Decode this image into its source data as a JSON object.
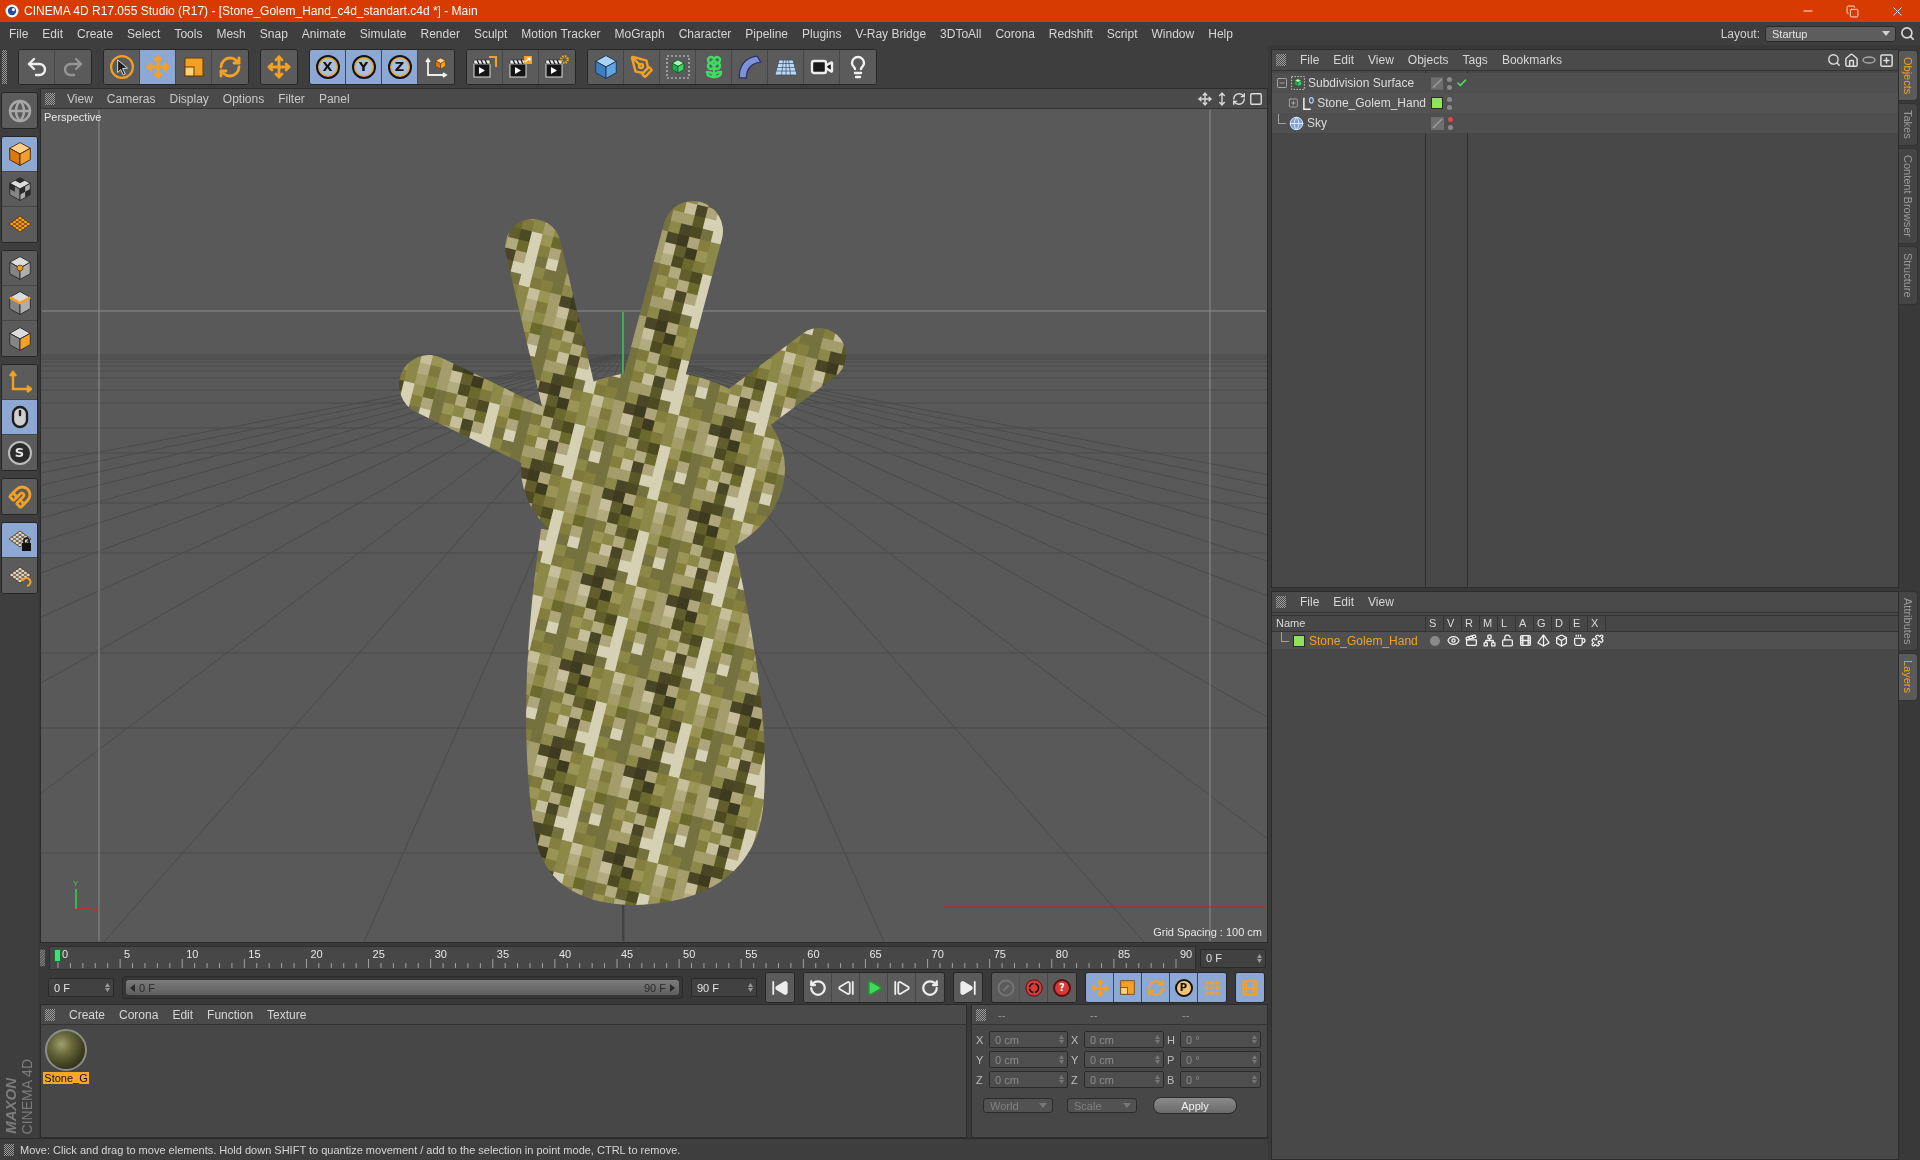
{
  "window": {
    "title": "CINEMA 4D R17.055 Studio (R17) - [Stone_Golem_Hand_c4d_standart.c4d *] - Main"
  },
  "menu_bar": {
    "items": [
      "File",
      "Edit",
      "Create",
      "Select",
      "Tools",
      "Mesh",
      "Snap",
      "Animate",
      "Simulate",
      "Render",
      "Sculpt",
      "Motion Tracker",
      "MoGraph",
      "Character",
      "Pipeline",
      "Plugins",
      "V-Ray Bridge",
      "3DToAll",
      "Corona",
      "Redshift",
      "Script",
      "Window",
      "Help"
    ],
    "layout_label": "Layout:",
    "layout_value": "Startup"
  },
  "toolbar": {
    "groups": [
      {
        "items": [
          {
            "kind": "undo",
            "disabled": false
          },
          {
            "kind": "redo",
            "disabled": true
          }
        ]
      },
      {
        "items": [
          {
            "kind": "select",
            "selected": false
          },
          {
            "kind": "move",
            "selected": true
          },
          {
            "kind": "scale",
            "selected": false
          },
          {
            "kind": "rotate",
            "selected": false
          }
        ]
      },
      {
        "items": [
          {
            "kind": "transform",
            "selected": false
          }
        ]
      },
      {
        "items": [
          {
            "kind": "axis",
            "label": "X",
            "selected": true
          },
          {
            "kind": "axis",
            "label": "Y",
            "selected": true
          },
          {
            "kind": "axis",
            "label": "Z",
            "selected": true
          },
          {
            "kind": "coords",
            "selected": false
          }
        ]
      },
      {
        "items": [
          {
            "kind": "render_view"
          },
          {
            "kind": "render_viewer"
          },
          {
            "kind": "render_settings"
          }
        ]
      },
      {
        "items": [
          {
            "kind": "cube"
          },
          {
            "kind": "pen"
          },
          {
            "kind": "subdivision"
          },
          {
            "kind": "cloner"
          },
          {
            "kind": "deformer"
          },
          {
            "kind": "floor"
          },
          {
            "kind": "camera"
          },
          {
            "kind": "light"
          }
        ]
      }
    ]
  },
  "left_toolbar": {
    "groups": [
      {
        "items": [
          {
            "kind": "make_editable"
          }
        ]
      },
      {
        "items": [
          {
            "kind": "model",
            "selected": true
          },
          {
            "kind": "texture",
            "selected": false
          },
          {
            "kind": "workplane",
            "selected": false
          }
        ]
      },
      {
        "items": [
          {
            "kind": "points",
            "selected": false
          },
          {
            "kind": "edges",
            "selected": false
          },
          {
            "kind": "polygons",
            "selected": false
          }
        ]
      },
      {
        "items": [
          {
            "kind": "axis_mode",
            "selected": false
          },
          {
            "kind": "tweak",
            "selected": true
          },
          {
            "kind": "solo",
            "label": "S",
            "selected": false
          }
        ]
      },
      {
        "items": [
          {
            "kind": "snap",
            "selected": false
          }
        ]
      },
      {
        "items": [
          {
            "kind": "workplane_lock",
            "selected": true
          },
          {
            "kind": "workplane_align",
            "selected": false
          }
        ]
      }
    ]
  },
  "viewport": {
    "menu": [
      "View",
      "Cameras",
      "Display",
      "Options",
      "Filter",
      "Panel"
    ],
    "camera": "Perspective",
    "axis_labels": [
      "Y",
      "X"
    ],
    "grid_spacing": "Grid Spacing : 100 cm"
  },
  "timeline": {
    "ticks": [
      "0",
      "5",
      "10",
      "15",
      "20",
      "25",
      "30",
      "35",
      "40",
      "45",
      "50",
      "55",
      "60",
      "65",
      "70",
      "75",
      "80",
      "85",
      "90"
    ],
    "playhead": {
      "level": 0
    },
    "frame_field": "0 F"
  },
  "transport": {
    "start_field": "0 F",
    "range_bar": {
      "start": "0 F",
      "end": "90 F",
      "level": 1
    },
    "end_field": "90 F",
    "groups": [
      {
        "items": [
          {
            "kind": "go_start"
          }
        ]
      },
      {
        "items": [
          {
            "kind": "prev_key"
          },
          {
            "kind": "step_back"
          },
          {
            "kind": "play"
          },
          {
            "kind": "step_forward"
          },
          {
            "kind": "next_key"
          }
        ]
      },
      {
        "items": [
          {
            "kind": "go_end"
          }
        ]
      },
      {
        "items": [
          {
            "kind": "autokey",
            "disabled": true
          },
          {
            "kind": "record",
            "disabled": false
          },
          {
            "kind": "key_selection",
            "label": "?",
            "disabled": false
          }
        ]
      },
      {
        "items": [
          {
            "kind": "move_key",
            "selected": true
          },
          {
            "kind": "scale_key",
            "selected": true
          },
          {
            "kind": "rotate_key",
            "selected": true
          },
          {
            "kind": "param",
            "label": "P",
            "selected": true
          },
          {
            "kind": "pla",
            "selected": true
          }
        ]
      },
      {
        "items": [
          {
            "kind": "timeline",
            "selected": true
          }
        ]
      }
    ]
  },
  "material_manager": {
    "menu": [
      "Create",
      "Corona",
      "Edit",
      "Function",
      "Texture"
    ],
    "materials": [
      {
        "name": "Stone_G",
        "selected": true
      }
    ]
  },
  "coordinates": {
    "headers": [
      "--",
      "--",
      "--"
    ],
    "rows": [
      {
        "labels": [
          "X",
          "X",
          "H"
        ],
        "values": [
          "0 cm",
          "0 cm",
          "0 °"
        ]
      },
      {
        "labels": [
          "Y",
          "Y",
          "P"
        ],
        "values": [
          "0 cm",
          "0 cm",
          "0 °"
        ]
      },
      {
        "labels": [
          "Z",
          "Z",
          "B"
        ],
        "values": [
          "0 cm",
          "0 cm",
          "0 °"
        ]
      }
    ],
    "mode": "World",
    "size_mode": "Scale",
    "apply": "Apply"
  },
  "status_bar": {
    "text": "Move: Click and drag to move elements. Hold down SHIFT to quantize movement / add to the selection in point mode, CTRL to remove."
  },
  "object_manager": {
    "menu": [
      "File",
      "Edit",
      "View",
      "Objects",
      "Tags",
      "Bookmarks"
    ],
    "objects": [
      {
        "kind": "subdivision",
        "name": "Subdivision Surface",
        "expanded": true,
        "hidden_in_editor": false,
        "hidden_in_render": false,
        "enabled": true,
        "children": [
          {
            "kind": "null",
            "name": "Stone_Golem_Hand",
            "expanded": false,
            "color": "#8fe35a",
            "hidden_in_editor": false,
            "hidden_in_render": false,
            "enabled": false
          }
        ]
      },
      {
        "kind": "sky",
        "name": "Sky",
        "hidden_in_editor": true,
        "hidden_in_render": false,
        "enabled": false
      }
    ]
  },
  "layer_manager": {
    "menu": [
      "File",
      "Edit",
      "View"
    ],
    "columns": [
      "Name",
      "S",
      "V",
      "R",
      "M",
      "L",
      "A",
      "G",
      "D",
      "E",
      "X"
    ],
    "layers": [
      {
        "name": "Stone_Golem_Hand",
        "color": "#8fe35a",
        "selected": true,
        "toggles": [
          {
            "on": false
          },
          {
            "on": true
          },
          {
            "on": true
          },
          {
            "on": true
          },
          {
            "on": true
          },
          {
            "on": true
          },
          {
            "on": true
          },
          {
            "on": true
          },
          {
            "on": true
          },
          {
            "on": true
          }
        ]
      }
    ]
  },
  "side_tabs": {
    "upper": [
      {
        "label": "Objects",
        "selected": true
      },
      {
        "label": "Takes",
        "selected": false
      },
      {
        "label": "Content Browser",
        "selected": false
      },
      {
        "label": "Structure",
        "selected": false
      }
    ],
    "lower": [
      {
        "label": "Attributes",
        "selected": false
      },
      {
        "label": "Layers",
        "selected": true
      }
    ]
  },
  "logo": {
    "brand": "MAXON",
    "product": "CINEMA 4D"
  }
}
